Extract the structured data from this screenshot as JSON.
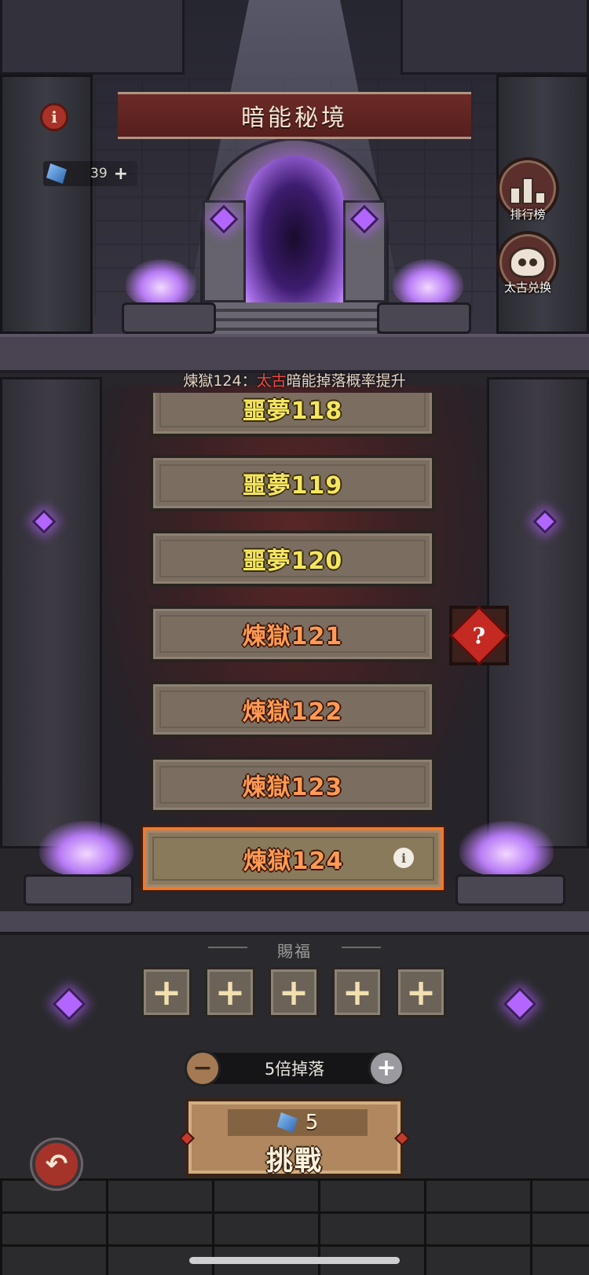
{
  "header": {
    "title": "暗能秘境",
    "info_icon": "info-icon",
    "currency": {
      "value": "39",
      "plus": "+"
    }
  },
  "side_buttons": {
    "ranking_label": "排行榜",
    "exchange_label": "太古兑换"
  },
  "notice": {
    "prefix": "煉獄124：",
    "highlight": "太古",
    "suffix": "暗能掉落概率提升"
  },
  "levels": [
    {
      "label": "噩夢118",
      "tier": "nightmare"
    },
    {
      "label": "噩夢119",
      "tier": "nightmare"
    },
    {
      "label": "噩夢120",
      "tier": "nightmare"
    },
    {
      "label": "煉獄121",
      "tier": "purgatory"
    },
    {
      "label": "煉獄122",
      "tier": "purgatory"
    },
    {
      "label": "煉獄123",
      "tier": "purgatory"
    },
    {
      "label": "煉獄124",
      "tier": "purgatory",
      "selected": true
    }
  ],
  "mystery_icon": "?",
  "blessing": {
    "title": "賜福",
    "slots": [
      "+",
      "+",
      "+",
      "+",
      "+"
    ]
  },
  "multiplier": {
    "minus": "−",
    "label": "5倍掉落",
    "plus": "+"
  },
  "challenge": {
    "cost": "5",
    "label": "挑戰"
  },
  "back_icon": "back-arrow-icon",
  "colors": {
    "title_bar": "#561f1d",
    "highlight_red": "#f0483a",
    "nightmare_text": "#f4e65f",
    "purgatory_text": "#ff9a55",
    "selected_border": "#f07a2a"
  }
}
